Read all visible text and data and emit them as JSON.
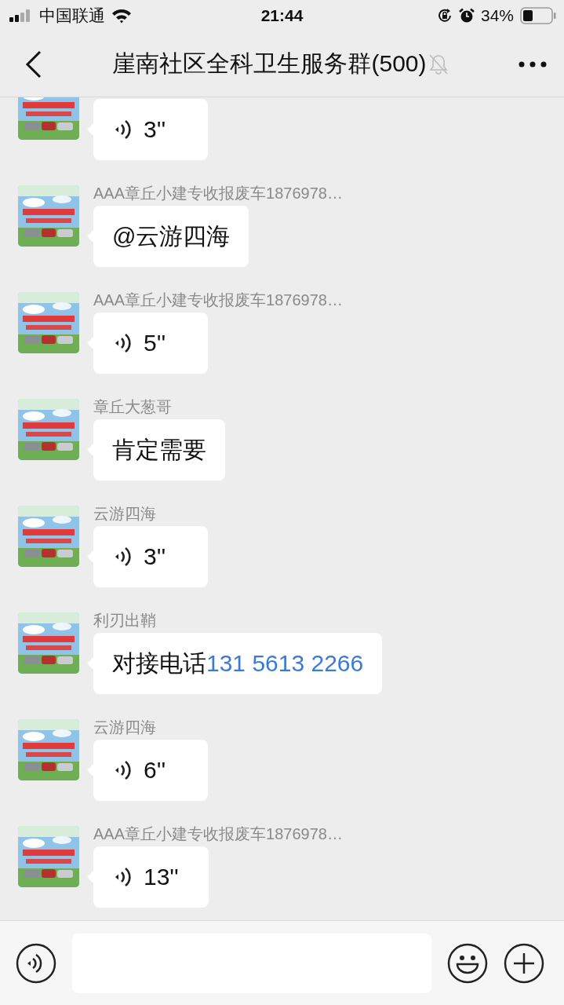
{
  "status_bar": {
    "carrier": "中国联通",
    "time": "21:44",
    "battery": "34%"
  },
  "chat": {
    "title": "崖南社区全科卫生服务群(500)",
    "muted": true
  },
  "messages": [
    {
      "kind": "voice",
      "duration": "3''"
    },
    {
      "sender": "AAA章丘小建专收报废车1876978…",
      "kind": "text",
      "text": "@云游四海"
    },
    {
      "sender": "AAA章丘小建专收报废车1876978…",
      "kind": "voice",
      "duration": "5''"
    },
    {
      "sender": "章丘大葱哥",
      "kind": "text",
      "text": "肯定需要"
    },
    {
      "sender": "云游四海",
      "kind": "voice",
      "duration": "3''"
    },
    {
      "sender": "利刃出鞘",
      "kind": "text",
      "text": "对接电话",
      "link": "131 5613 2266"
    },
    {
      "sender": "云游四海",
      "kind": "voice",
      "duration": "6''"
    },
    {
      "sender": "AAA章丘小建专收报废车1876978…",
      "kind": "voice",
      "duration": "13''"
    }
  ]
}
